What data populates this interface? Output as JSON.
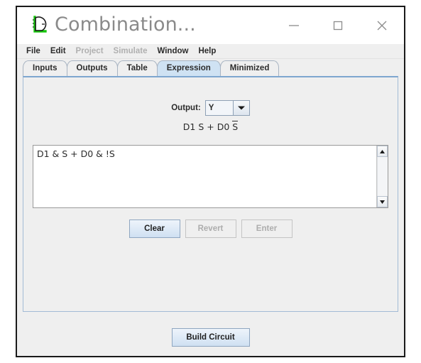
{
  "window": {
    "title": "Combination...",
    "icon": "logic-gate-icon",
    "controls": {
      "minimize": "—",
      "maximize": "□",
      "close": "✕"
    }
  },
  "menu": {
    "items": [
      {
        "label": "File",
        "enabled": true
      },
      {
        "label": "Edit",
        "enabled": true
      },
      {
        "label": "Project",
        "enabled": false
      },
      {
        "label": "Simulate",
        "enabled": false
      },
      {
        "label": "Window",
        "enabled": true
      },
      {
        "label": "Help",
        "enabled": true
      }
    ]
  },
  "tabs": {
    "items": [
      {
        "label": "Inputs",
        "selected": false
      },
      {
        "label": "Outputs",
        "selected": false
      },
      {
        "label": "Table",
        "selected": false
      },
      {
        "label": "Expression",
        "selected": true
      },
      {
        "label": "Minimized",
        "selected": false
      }
    ]
  },
  "expression_panel": {
    "output_label": "Output:",
    "output_value": "Y",
    "output_options": [
      "Y"
    ],
    "formula": {
      "full": "D1 S + D0 S̅",
      "part1": "D1 S + D0 ",
      "part2_overlined": "S"
    },
    "expression_text": "D1 & S + D0 & !S",
    "expression_placeholder": "",
    "buttons": [
      {
        "label": "Clear",
        "enabled": true,
        "primary": true
      },
      {
        "label": "Revert",
        "enabled": false,
        "primary": false
      },
      {
        "label": "Enter",
        "enabled": false,
        "primary": false
      }
    ],
    "scrollbar": {
      "up": "scroll-up-icon",
      "down": "scroll-down-icon"
    }
  },
  "footer": {
    "build_button": "Build Circuit"
  },
  "colors": {
    "accent": "#cfe2f3",
    "tab_border": "#a8b4c2",
    "panel_bg": "#efefef",
    "title_text": "#8a8a8a",
    "icon_green": "#16c60c"
  }
}
